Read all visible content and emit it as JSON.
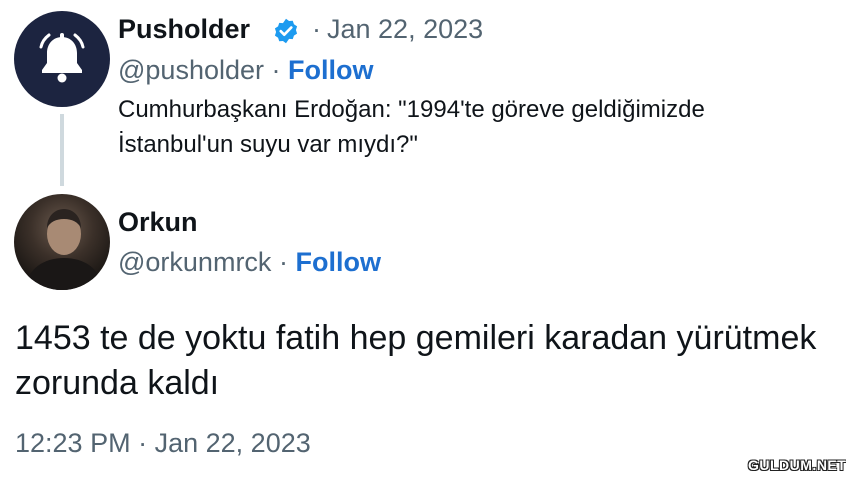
{
  "first_tweet": {
    "display_name": "Pusholder",
    "verified_icon": "verified-badge-icon",
    "date": "Jan 22, 2023",
    "separator": "·",
    "handle": "@pusholder",
    "follow_label": "Follow",
    "text": "Cumhurbaşkanı Erdoğan: \"1994'te göreve geldiğimizde İstanbul'un suyu var mıydı?\"",
    "avatar_icon": "bell-icon"
  },
  "reply_tweet": {
    "display_name": "Orkun",
    "handle": "@orkunmrck",
    "separator": "·",
    "follow_label": "Follow",
    "text": "1453 te de yoktu fatih hep gemileri karadan yürütmek zorunda kaldı",
    "time": "12:23 PM",
    "date": "Jan 22, 2023"
  },
  "watermark": "GULDUM.NET",
  "colors": {
    "accent": "#1d6fd0",
    "verified": "#1d9bf0",
    "muted": "#536471",
    "text": "#0f1419",
    "avatar_bg": "#1c2440"
  }
}
